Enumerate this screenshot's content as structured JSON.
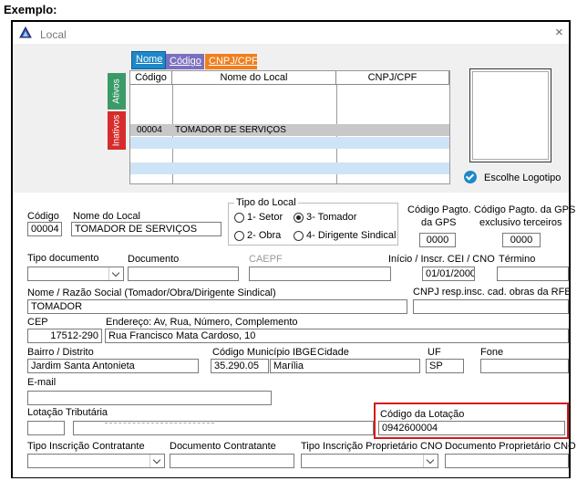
{
  "heading": "Exemplo:",
  "window": {
    "title": "Local",
    "close_glyph": "×"
  },
  "tabs": {
    "nome": "Nome",
    "codigo": "Código",
    "cnpj": "CNPJ/CPF",
    "ativos": "Ativos",
    "inativos": "Inativos"
  },
  "grid": {
    "columns": [
      "Código",
      "Nome do Local",
      "CNPJ/CPF"
    ],
    "rows": [
      {
        "codigo": "00004",
        "nome": "TOMADOR DE SERVIÇOS",
        "cnpj": ""
      }
    ]
  },
  "logo": {
    "button_label": "Escolhe Logotipo"
  },
  "form": {
    "codigo": {
      "label": "Código",
      "value": "00004"
    },
    "nome_local": {
      "label": "Nome do Local",
      "value": "TOMADOR DE SERVIÇOS"
    },
    "tipo_local": {
      "label": "Tipo do Local",
      "options": [
        "1- Setor",
        "3- Tomador",
        "2- Obra",
        "4- Dirigente Sindical"
      ],
      "selected": "3- Tomador"
    },
    "codigo_pagto_gps": {
      "label_line1": "Código Pagto.",
      "label_line2": "da GPS",
      "value": "0000"
    },
    "codigo_pagto_gps_terceiros": {
      "label_line1": "Código Pagto. da GPS",
      "label_line2": "exclusivo terceiros",
      "value": "0000"
    },
    "tipo_documento": {
      "label": "Tipo documento",
      "value": ""
    },
    "documento": {
      "label": "Documento",
      "value": ""
    },
    "caepf": {
      "label": "CAEPF",
      "value": ""
    },
    "inicio": {
      "label": "Início / Inscr. CEI / CNO",
      "value": "01/01/2000"
    },
    "termino": {
      "label": "Término",
      "value": ""
    },
    "nome_razao": {
      "label": "Nome / Razão Social (Tomador/Obra/Dirigente Sindical)",
      "value": "TOMADOR"
    },
    "cnpj_resp": {
      "label": "CNPJ resp.insc. cad. obras da RFB",
      "value": ""
    },
    "cep": {
      "label": "CEP",
      "value": "17512-290"
    },
    "endereco": {
      "label": "Endereço: Av, Rua, Número, Complemento",
      "value": "Rua Francisco Mata Cardoso, 10"
    },
    "bairro": {
      "label": "Bairro / Distrito",
      "value": "Jardim Santa Antonieta"
    },
    "codigo_municipio": {
      "label": "Código Município IBGE",
      "value": "35.290.05"
    },
    "cidade": {
      "label": "Cidade",
      "value": "Marília"
    },
    "uf": {
      "label": "UF",
      "value": "SP"
    },
    "fone": {
      "label": "Fone",
      "value": ""
    },
    "email": {
      "label": "E-mail",
      "value": ""
    },
    "lotacao_tributaria": {
      "label": "Lotação Tributária",
      "value": ""
    },
    "codigo_lotacao": {
      "label": "Código da Lotação",
      "value": "0942600004"
    },
    "tipo_insc_contratante": {
      "label": "Tipo Inscrição Contratante",
      "value": ""
    },
    "documento_contratante": {
      "label": "Documento Contratante",
      "value": ""
    },
    "tipo_insc_proprietario": {
      "label": "Tipo Inscrição Proprietário CNO",
      "value": ""
    },
    "documento_proprietario": {
      "label": "Documento Proprietário CNO",
      "value": ""
    }
  },
  "colors": {
    "tab_nome": "#1e88c9",
    "tab_codigo": "#7b6fbf",
    "tab_cnpj": "#f07f1e",
    "tab_ativos": "#3a9b69",
    "tab_inativos": "#d62c2c",
    "selected_row": "#c8c8c8",
    "alt_row": "#cfe3f6",
    "highlight_border": "#d21b1b"
  }
}
